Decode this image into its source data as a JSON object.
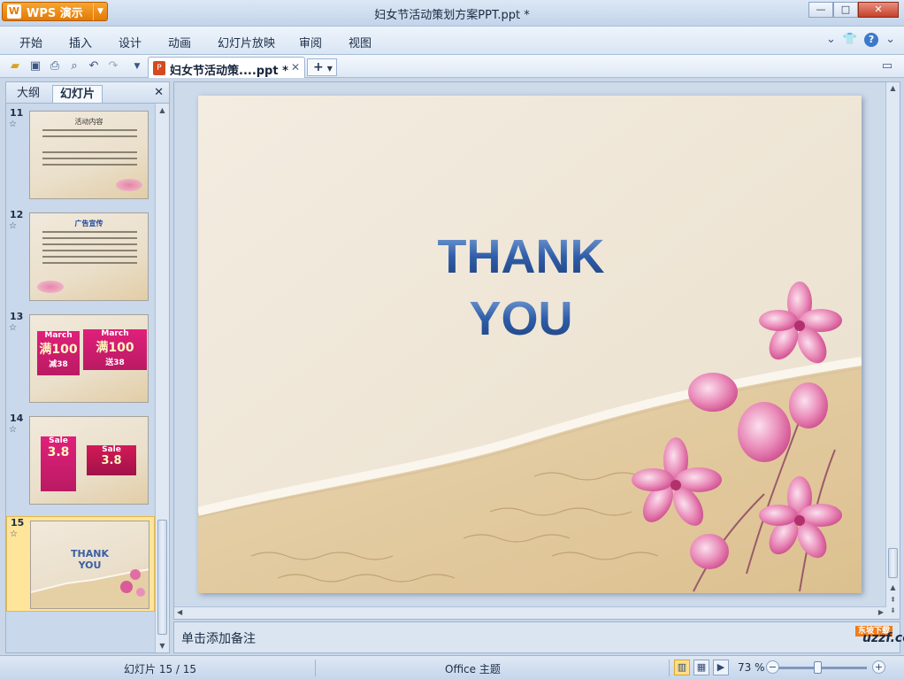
{
  "app": {
    "name": "WPS 演示",
    "title": "妇女节活动策划方案PPT.ppt *"
  },
  "window": {
    "minimize": "—",
    "maximize": "□",
    "close": "✕"
  },
  "menu": [
    "开始",
    "插入",
    "设计",
    "动画",
    "幻灯片放映",
    "审阅",
    "视图"
  ],
  "toolbar": {
    "icons": [
      "open-folder-icon",
      "save-icon",
      "print-icon",
      "print-preview-icon",
      "undo-icon",
      "redo-icon",
      "dropdown-icon"
    ],
    "doc_tab": "妇女节活动策....ppt *",
    "tab_close": "✕",
    "new_tab": "+"
  },
  "leftpane": {
    "tabs": [
      "大纲",
      "幻灯片"
    ],
    "close": "✕",
    "slides": [
      {
        "num": "11",
        "title": "活动内容"
      },
      {
        "num": "12",
        "title": "广告宣传"
      },
      {
        "num": "13",
        "title": ""
      },
      {
        "num": "14",
        "title": ""
      },
      {
        "num": "15",
        "title": "THANK YOU"
      }
    ],
    "thumb_cards": {
      "s13_left": {
        "head": "March",
        "tag": "满100",
        "sub": "减38"
      },
      "s13_right": {
        "head": "March",
        "tag": "满100",
        "sub": "送38"
      },
      "s14_left": {
        "head": "Sale",
        "big": "3.8"
      },
      "s14_right": {
        "head": "Sale",
        "big": "3.8"
      }
    }
  },
  "slide": {
    "line1": "THANK",
    "line2": "YOU"
  },
  "notes": {
    "placeholder": "单击添加备注",
    "watermark": "uzzf.com",
    "watermark_tag": "东坡下载"
  },
  "status": {
    "slide_info": "幻灯片 15 / 15",
    "theme": "Office 主题",
    "zoom": "73 %"
  }
}
